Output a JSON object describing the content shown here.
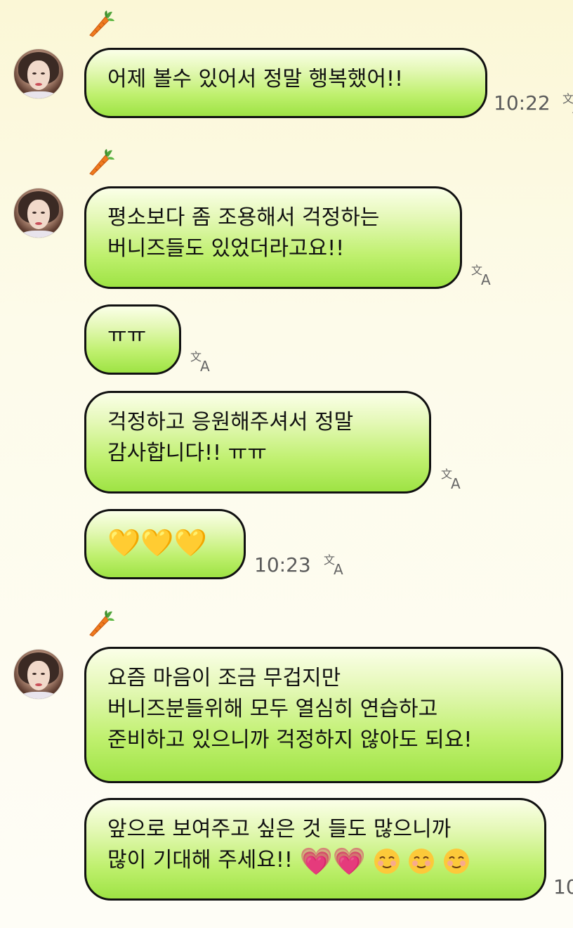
{
  "messages": [
    {
      "text_lines": [
        "어제 볼수 있어서 정말  행복했어!!"
      ],
      "time": "10:22"
    },
    {
      "text_lines": [
        "평소보다 좀 조용해서 걱정하는",
        "버니즈들도 있었더라고요!!"
      ]
    },
    {
      "text_lines": [
        "ㅠㅠ"
      ]
    },
    {
      "text_lines": [
        "걱정하고 응원해주셔서 정말",
        "감사합니다!! ㅠㅠ"
      ]
    },
    {
      "emoji": [
        "💛",
        "💛",
        "💛"
      ],
      "time": "10:23"
    },
    {
      "text_lines": [
        "요즘 마음이 조금 무겁지만",
        "버니즈분들위해 모두 열심히 연습하고",
        "준비하고 있으니까 걱정하지 않아도 되요!"
      ]
    },
    {
      "text_lines": [
        "앞으로 보여주고 싶은 것 들도 많으니까",
        "많이 기대해 주세요!!"
      ],
      "emoji": [
        "💗",
        "💗",
        "☺️",
        "☺️",
        "☺️"
      ],
      "time": "10"
    }
  ],
  "icons": {
    "sender_badge": "carrot-icon",
    "translate": "translate-icon",
    "avatar": "avatar"
  },
  "colors": {
    "bubble_top": "#fbffe8",
    "bubble_bottom": "#9ee344",
    "bubble_border": "#111111",
    "timestamp": "#5a5a5a",
    "background": "#fbf7d6"
  }
}
